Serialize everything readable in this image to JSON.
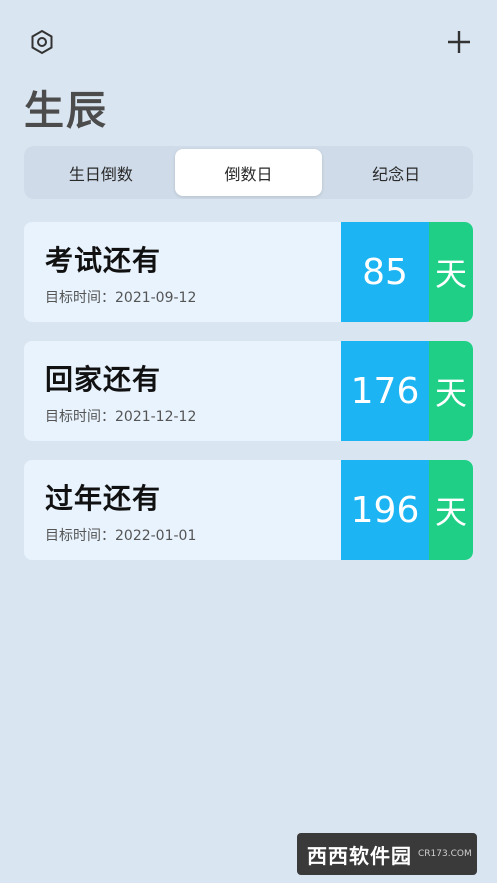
{
  "header": {
    "settings_icon": "gear-icon",
    "add_icon": "plus-icon"
  },
  "page": {
    "title": "生辰"
  },
  "tabs": [
    {
      "label": "生日倒数",
      "active": false
    },
    {
      "label": "倒数日",
      "active": true
    },
    {
      "label": "纪念日",
      "active": false
    }
  ],
  "cards": [
    {
      "title": "考试还有",
      "date_label": "目标时间：",
      "date": "2021-09-12",
      "days": "85",
      "unit": "天"
    },
    {
      "title": "回家还有",
      "date_label": "目标时间：",
      "date": "2021-12-12",
      "days": "176",
      "unit": "天"
    },
    {
      "title": "过年还有",
      "date_label": "目标时间：",
      "date": "2022-01-01",
      "days": "196",
      "unit": "天"
    }
  ],
  "watermark": {
    "logo": "西西软件园",
    "sub": "CR173.COM"
  },
  "colors": {
    "background": "#d9e6f2",
    "card": "#e8f3fd",
    "days_blue": "#1cb4f2",
    "unit_green": "#1fcf86"
  }
}
